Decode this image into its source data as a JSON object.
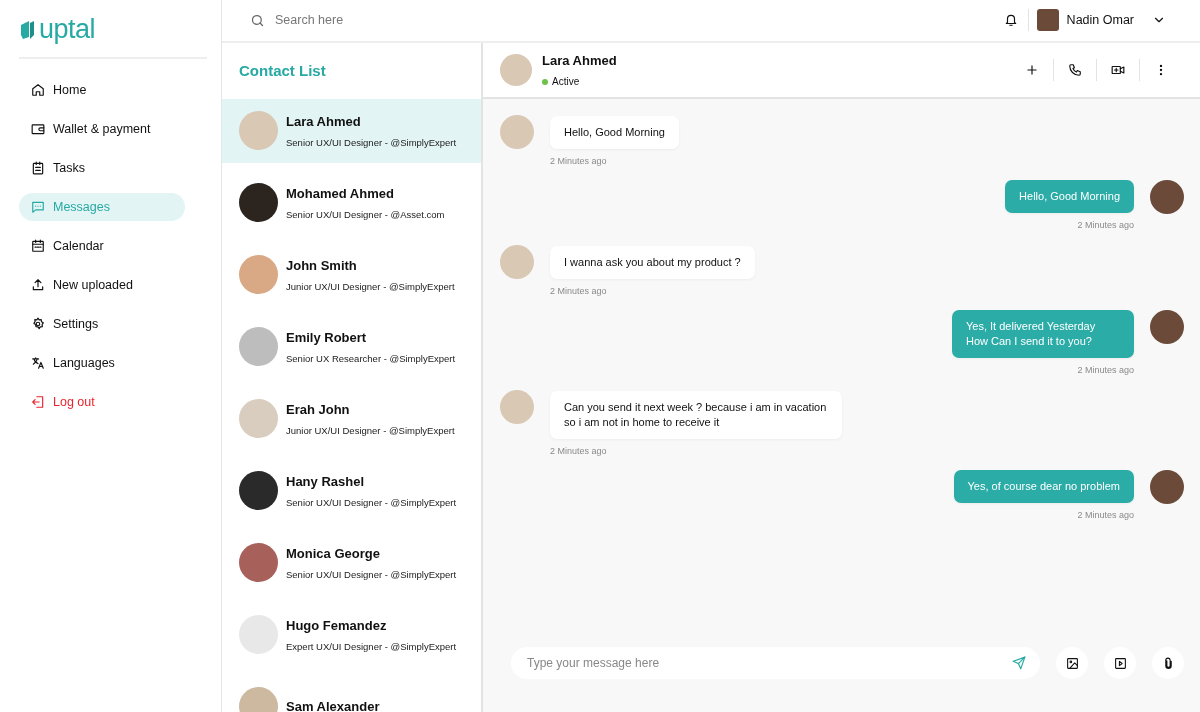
{
  "logo": {
    "text": "uptal"
  },
  "nav": [
    {
      "label": "Home",
      "selected": false,
      "kind": "link"
    },
    {
      "label": "Wallet & payment",
      "selected": false,
      "kind": "link"
    },
    {
      "label": "Tasks",
      "selected": false,
      "kind": "link"
    },
    {
      "label": "Messages",
      "selected": true,
      "kind": "link"
    },
    {
      "label": "Calendar",
      "selected": false,
      "kind": "link"
    },
    {
      "label": "New uploaded",
      "selected": false,
      "kind": "link"
    },
    {
      "label": "Settings",
      "selected": false,
      "kind": "link"
    },
    {
      "label": "Languages",
      "selected": false,
      "kind": "link"
    },
    {
      "label": "Log out",
      "selected": false,
      "kind": "danger"
    }
  ],
  "search": {
    "placeholder": "Search here"
  },
  "user": {
    "name": "Nadin Omar"
  },
  "contacts": {
    "title": "Contact List",
    "items": [
      {
        "name": "Lara Ahmed",
        "role": "Senior UX/UI Designer - @SimplyExpert",
        "selected": true
      },
      {
        "name": "Mohamed Ahmed",
        "role": "Senior UX/UI Designer - @Asset.com",
        "selected": false
      },
      {
        "name": "John Smith",
        "role": "Junior UX/UI Designer - @SimplyExpert",
        "selected": false
      },
      {
        "name": "Emily Robert",
        "role": "Senior UX Researcher - @SimplyExpert",
        "selected": false
      },
      {
        "name": "Erah John",
        "role": "Junior UX/UI Designer - @SimplyExpert",
        "selected": false
      },
      {
        "name": "Hany Rashel",
        "role": "Senior UX/UI Designer - @SimplyExpert",
        "selected": false
      },
      {
        "name": "Monica George",
        "role": "Senior UX/UI Designer - @SimplyExpert",
        "selected": false
      },
      {
        "name": "Hugo Femandez",
        "role": "Expert UX/UI Designer - @SimplyExpert",
        "selected": false
      },
      {
        "name": "Sam Alexander",
        "selected": false
      }
    ]
  },
  "chat": {
    "contact": {
      "name": "Lara Ahmed",
      "status": "Active",
      "online": true
    },
    "messages": [
      {
        "kind": "incoming",
        "text": "Hello, Good Morning",
        "time": "2 Minutes ago"
      },
      {
        "kind": "outgoing",
        "text": "Hello, Good Morning",
        "time": "2 Minutes ago"
      },
      {
        "kind": "incoming",
        "text": "I wanna ask you about my product ?",
        "time": "2 Minutes ago"
      },
      {
        "kind": "outgoing",
        "text": "Yes, It delivered Yesterday How Can I send it to you?",
        "time": "2 Minutes ago"
      },
      {
        "kind": "incoming",
        "text": "Can you send it next week ? because i am in vacation so i am not in home to receive it",
        "time": "2 Minutes ago"
      },
      {
        "kind": "outgoing",
        "text": "Yes, of course dear no problem",
        "time": "2 Minutes ago"
      }
    ],
    "composer": {
      "placeholder": "Type your message here"
    }
  }
}
